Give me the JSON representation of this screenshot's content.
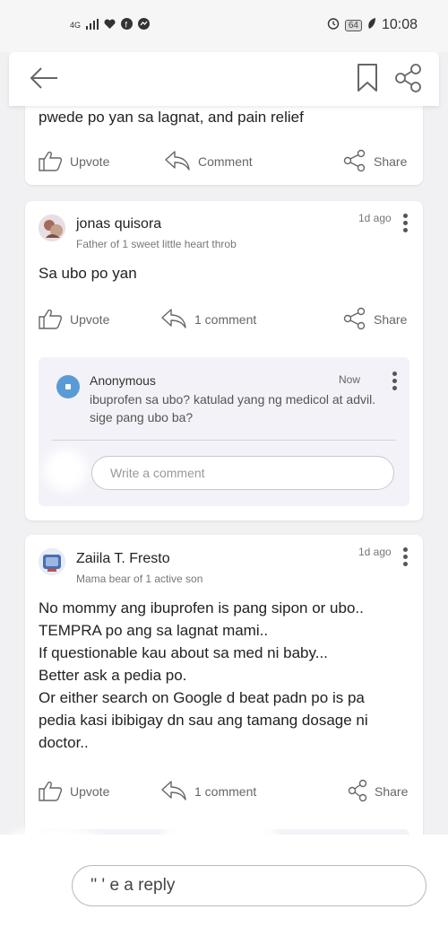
{
  "status_bar": {
    "network": "4G",
    "battery": "64",
    "time": "10:08"
  },
  "app_bar": {
    "back_icon": "arrow-left-icon",
    "bookmark_icon": "bookmark-icon",
    "share_icon": "share-icon"
  },
  "post1": {
    "text": "pwede po yan sa lagnat, and pain relief",
    "upvote": "Upvote",
    "comment": "Comment",
    "share": "Share"
  },
  "post2": {
    "author": "jonas quisora",
    "bio": "Father of 1 sweet little heart throb",
    "time": "1d ago",
    "text": "Sa ubo po yan",
    "upvote": "Upvote",
    "comment": "1 comment",
    "share": "Share",
    "reply": {
      "author": "Anonymous",
      "time": "Now",
      "text": "ibuprofen sa ubo? katulad yang ng medicol at advil. sige pang ubo ba?"
    },
    "write_placeholder": "Write a comment"
  },
  "post3": {
    "author": "Zaiila T. Fresto",
    "bio": "Mama bear of 1 active son",
    "time": "1d ago",
    "lines": [
      "No mommy ang ibuprofen is pang sipon or ubo..",
      "TEMPRA po ang sa lagnat mami..",
      "If questionable kau about sa med ni baby...",
      "Better ask a pedia po.",
      "Or either search on Google d beat padn po is pa",
      "pedia kasi ibibigay dn sau ang tamang dosage ni",
      "doctor.."
    ],
    "upvote": "Upvote",
    "comment": "1 comment",
    "share": "Share"
  },
  "reply_bar": {
    "placeholder": "'' ' e a reply"
  }
}
